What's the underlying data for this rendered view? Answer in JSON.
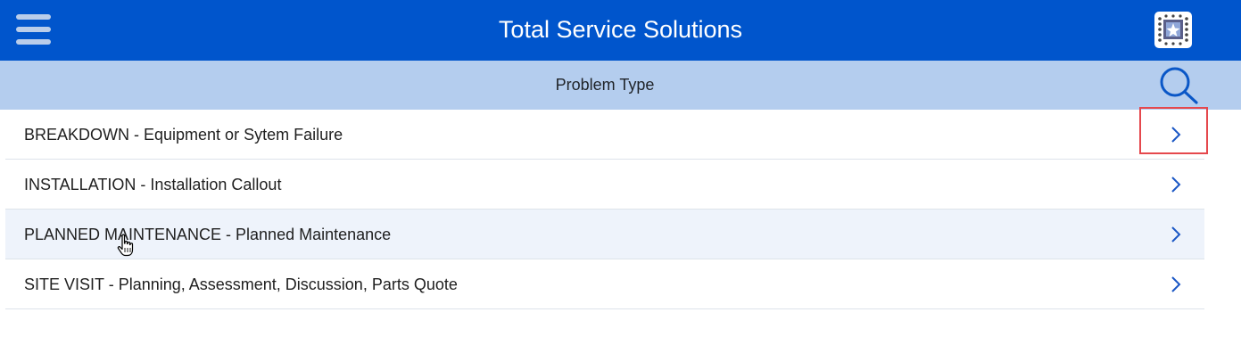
{
  "header": {
    "title": "Total Service Solutions",
    "menu_icon": "hamburger-menu-icon",
    "logo_icon": "app-logo-icon",
    "background_color": "#0055cc"
  },
  "subheader": {
    "title": "Problem Type",
    "search_icon": "search-icon",
    "background_color": "#b4cdee"
  },
  "problem_types": [
    {
      "label": "BREAKDOWN - Equipment or Sytem Failure",
      "chevron_icon": "chevron-right-icon"
    },
    {
      "label": "INSTALLATION - Installation Callout",
      "chevron_icon": "chevron-right-icon"
    },
    {
      "label": "PLANNED MAINTENANCE - Planned Maintenance",
      "chevron_icon": "chevron-right-icon",
      "hovered": true
    },
    {
      "label": "SITE VISIT - Planning, Assessment, Discussion, Parts Quote",
      "chevron_icon": "chevron-right-icon"
    }
  ],
  "annotation": {
    "highlight_color": "#e5484d",
    "cursor_icon": "hand-pointer-cursor-icon"
  }
}
